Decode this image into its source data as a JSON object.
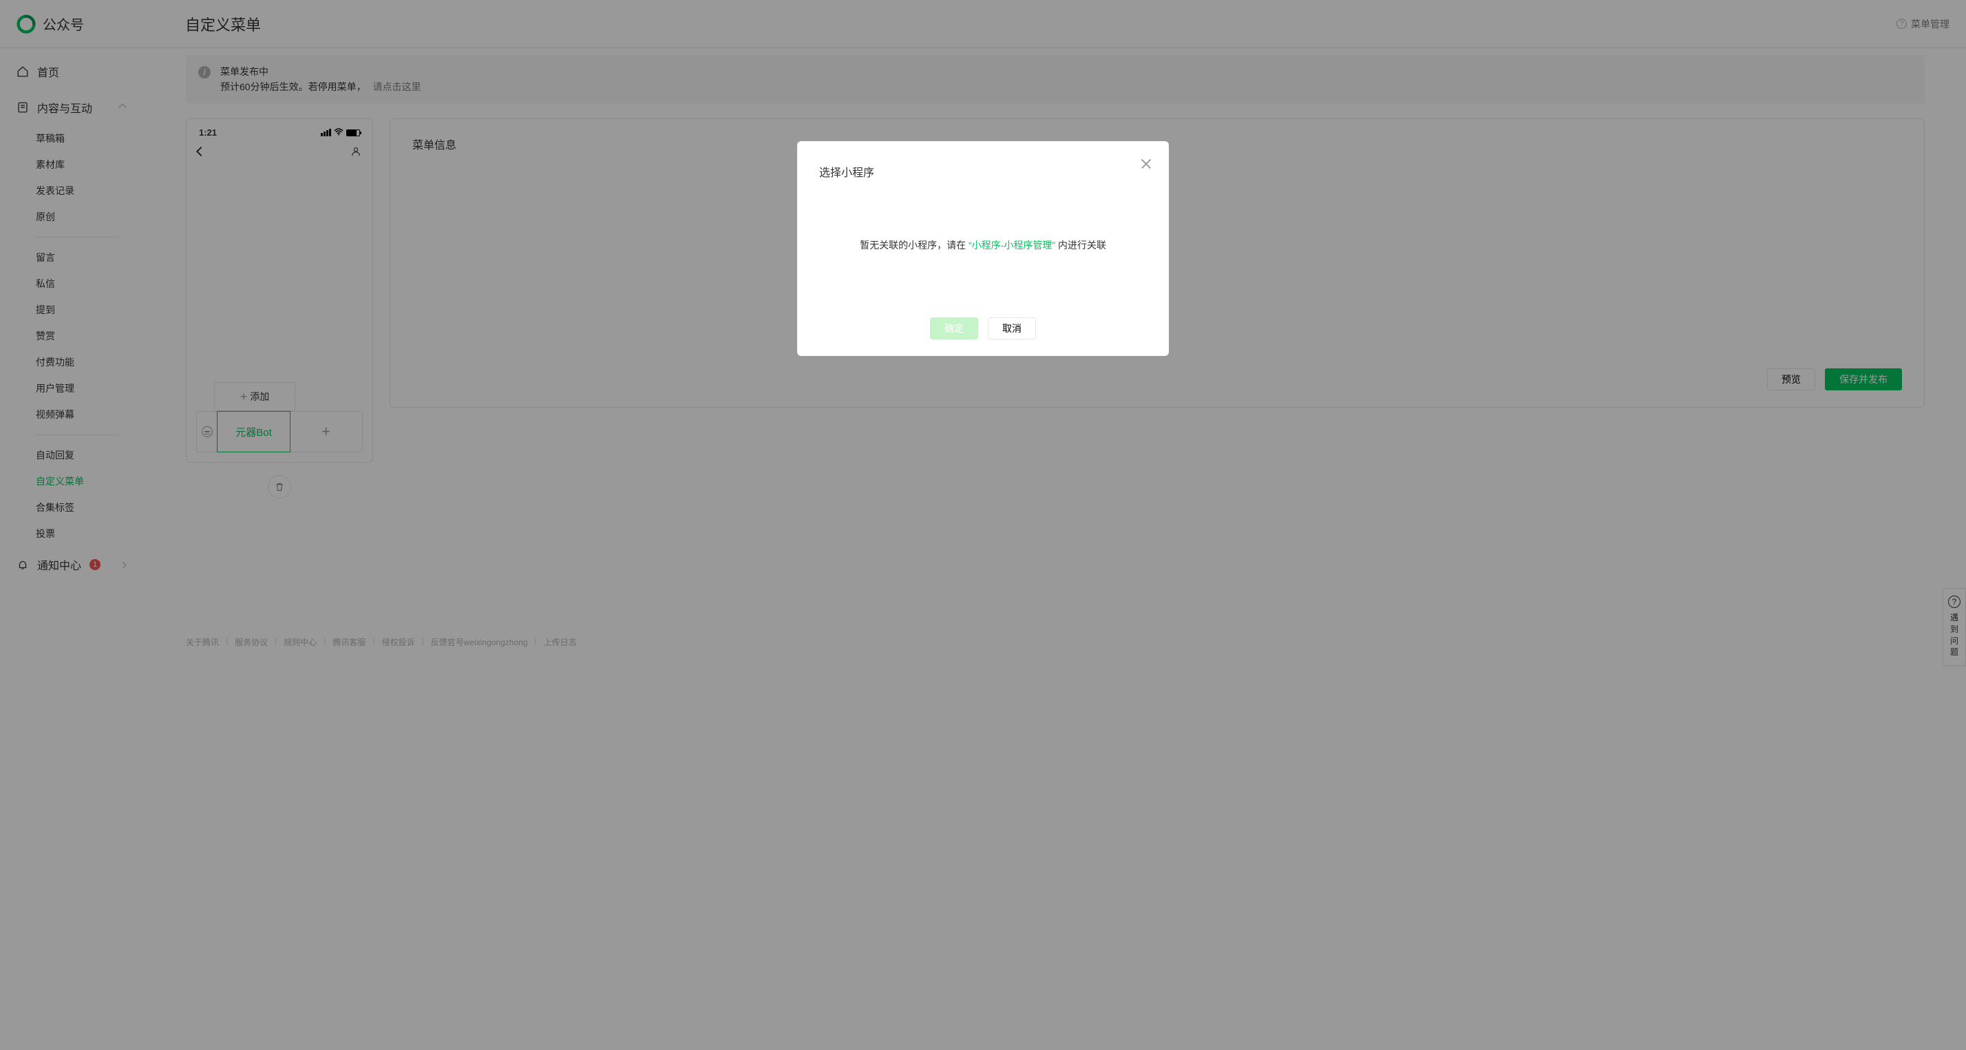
{
  "header": {
    "brand": "公众号",
    "page_title": "自定义菜单",
    "help_link": "菜单管理"
  },
  "sidebar": {
    "home": "首页",
    "group1_title": "内容与互动",
    "items_a": [
      "草稿箱",
      "素材库",
      "发表记录",
      "原创"
    ],
    "items_b": [
      "留言",
      "私信",
      "提到",
      "赞赏",
      "付费功能",
      "用户管理",
      "视频弹幕"
    ],
    "items_c": [
      "自动回复",
      "自定义菜单",
      "合集标签",
      "投票"
    ],
    "active": "自定义菜单",
    "notification_label": "通知中心",
    "notification_count": "1"
  },
  "notice": {
    "line1": "菜单发布中",
    "line2_a": "预计60分钟后生效。若停用菜单，",
    "line2_link": "请点击这里"
  },
  "phone": {
    "clock": "1:21",
    "add_sub_label": "添加",
    "menu1_label": "元器Bot"
  },
  "panel": {
    "title": "菜单信息",
    "preview_btn": "预览",
    "publish_btn": "保存并发布"
  },
  "modal": {
    "title": "选择小程序",
    "body_before": "暂无关联的小程序，请在 ",
    "body_link": "“小程序-小程序管理”",
    "body_after": " 内进行关联",
    "confirm": "确定",
    "cancel": "取消"
  },
  "floater": {
    "text": "遇到问题"
  },
  "footer": {
    "links": [
      "关于腾讯",
      "服务协议",
      "规则中心",
      "腾讯客服",
      "侵权投诉",
      "反馈官号weixingongzhong",
      "上传日志"
    ]
  }
}
